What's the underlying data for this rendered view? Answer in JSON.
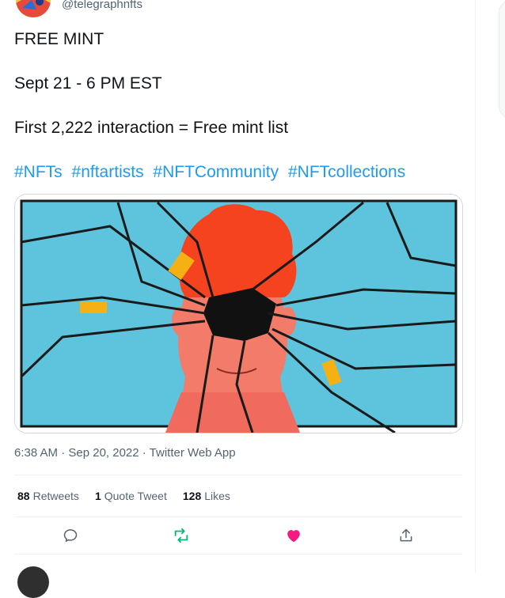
{
  "tweet": {
    "handle": "@telegraphnfts",
    "lines": [
      "FREE MINT",
      "Sept 21 - 6 PM EST",
      "First 2,222 interaction = Free mint list"
    ],
    "hashtags": [
      "#NFTs",
      "#nftartists",
      "#NFTCommunity",
      "#NFTcollections"
    ],
    "timestamp": "6:38 AM · Sep 20, 2022 · Twitter Web App"
  },
  "stats": {
    "retweets_count": "88",
    "retweets_label": "Retweets",
    "quotes_count": "1",
    "quotes_label": "Quote Tweet",
    "likes_count": "128",
    "likes_label": "Likes"
  },
  "icons": {
    "reply": "reply-icon",
    "retweet": "retweet-icon",
    "like": "heart-icon",
    "share": "share-icon"
  },
  "colors": {
    "link": "#1d9bf0",
    "retweet": "#00ba7c",
    "like": "#f91880",
    "muted": "#536471"
  }
}
